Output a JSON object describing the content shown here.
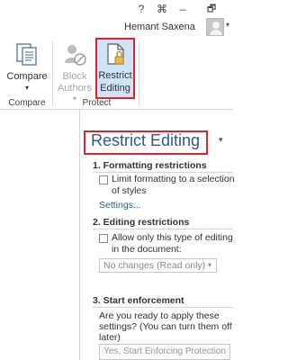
{
  "window_controls": {
    "help": "?",
    "ribbon_display": "⌘",
    "minimize": "–",
    "restore": "🗗"
  },
  "account": {
    "name": "Hemant Saxena",
    "chevron": "▾"
  },
  "ribbon": {
    "compare_group": {
      "label": "Compare",
      "compare_button": {
        "label": "Compare",
        "dropdown": "▾",
        "icon": "compare-documents-icon"
      }
    },
    "protect_group": {
      "label": "Protect",
      "block_authors": {
        "line1": "Block",
        "line2": "Authors",
        "dropdown": "▾",
        "icon": "block-authors-icon",
        "enabled": false
      },
      "restrict_editing": {
        "line1": "Restrict",
        "line2": "Editing",
        "icon": "restrict-editing-icon",
        "active": true
      }
    }
  },
  "pane": {
    "title": "Restrict Editing",
    "menu_arrow": "▾",
    "sections": {
      "formatting": {
        "heading": "1. Formatting restrictions",
        "checkbox_line1": "Limit formatting to a selection",
        "checkbox_line2": "of styles",
        "checked": false,
        "settings_link": "Settings..."
      },
      "editing": {
        "heading": "2. Editing restrictions",
        "checkbox_line1": "Allow only this type of editing",
        "checkbox_line2": "in the document:",
        "checked": false,
        "select_value": "No changes (Read only)",
        "select_arrow": "▾"
      },
      "enforcement": {
        "heading": "3. Start enforcement",
        "question_line1": "Are you ready to apply these",
        "question_line2": "settings? (You can turn them off",
        "question_line3": "later)",
        "button_label": "Yes, Start Enforcing Protection"
      }
    }
  },
  "colors": {
    "accent_blue": "#2b579a",
    "highlight_red": "#d9262c",
    "active_button_bg": "#cfe4f7"
  }
}
